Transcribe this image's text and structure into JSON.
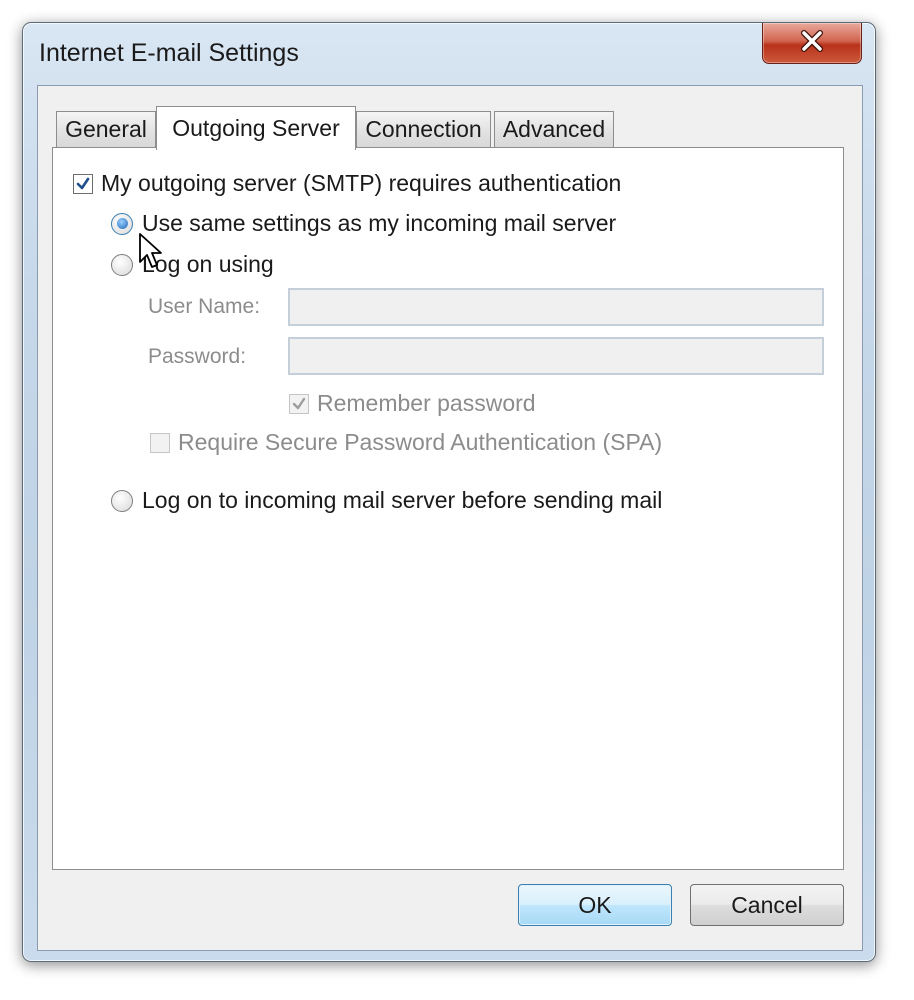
{
  "window": {
    "title": "Internet E-mail Settings",
    "close_icon": "close-x-icon"
  },
  "tabs": [
    {
      "label": "General",
      "selected": false
    },
    {
      "label": "Outgoing Server",
      "selected": true
    },
    {
      "label": "Connection",
      "selected": false
    },
    {
      "label": "Advanced",
      "selected": false
    }
  ],
  "outgoing": {
    "smtp_auth": {
      "label": "My outgoing server (SMTP) requires authentication",
      "checked": true
    },
    "same_settings": {
      "label": "Use same settings as my incoming mail server",
      "selected": true
    },
    "log_on_using": {
      "label": "Log on using",
      "selected": false
    },
    "user_name": {
      "label": "User Name:",
      "value": ""
    },
    "password": {
      "label": "Password:",
      "value": ""
    },
    "remember_password": {
      "label": "Remember password",
      "checked": true,
      "enabled": false
    },
    "spa": {
      "label": "Require Secure Password Authentication (SPA)",
      "checked": false,
      "enabled": false
    },
    "log_on_incoming": {
      "label": "Log on to incoming mail server before sending mail",
      "selected": false
    }
  },
  "buttons": {
    "ok": "OK",
    "cancel": "Cancel"
  },
  "colors": {
    "accent": "#3c7fb1",
    "close_red": "#c8432b",
    "disabled_text": "#8c8c8c"
  }
}
